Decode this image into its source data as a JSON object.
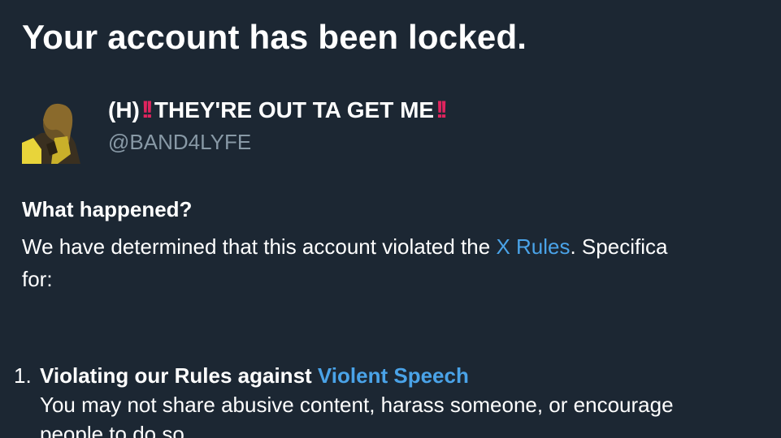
{
  "page": {
    "title": "Your account has been locked."
  },
  "account": {
    "name_prefix": "(H)",
    "name_bangs_1": "!!",
    "name_main": "THEY'RE OUT TA GET ME",
    "name_bangs_2": "!!",
    "handle": "@BAND4LYFE",
    "avatar_icon": "profile-avatar-photo"
  },
  "what_happened": {
    "heading": "What happened?",
    "line1_before": "We have determined that this account violated the ",
    "rules_link": "X Rules",
    "line1_after": ". Specifica",
    "line2": "for:"
  },
  "violations": [
    {
      "number": "1.",
      "title_prefix": "Violating our Rules against ",
      "title_link": "Violent Speech",
      "desc_line1": "You may not share abusive content, harass someone, or encourage",
      "desc_line2": "people to do so."
    }
  ],
  "colors": {
    "background": "#1c2733",
    "text": "#ffffff",
    "secondary_text": "#8899a6",
    "link": "#4aa3e8",
    "accent_red": "#e0245e"
  }
}
